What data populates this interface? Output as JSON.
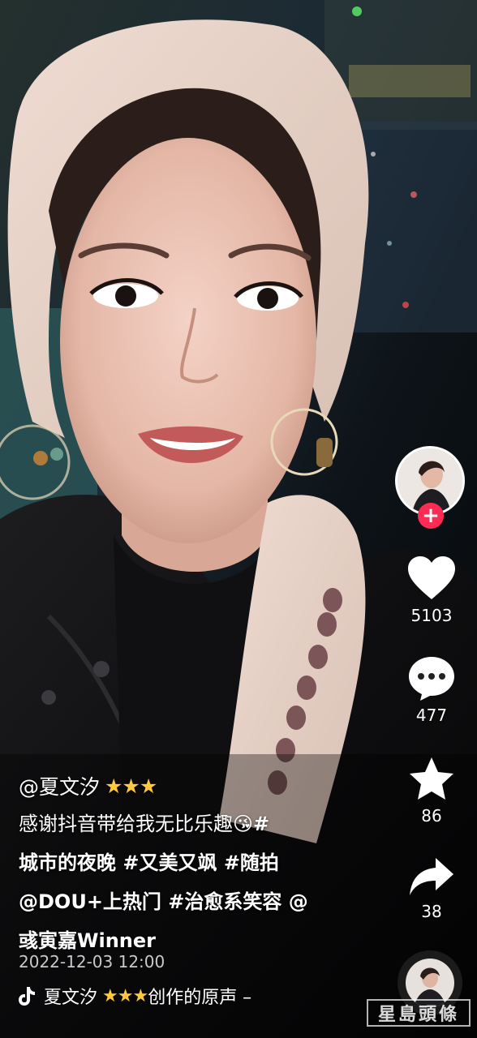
{
  "video": {
    "description_icon": "selfie-video-frame"
  },
  "sidebar": {
    "avatar_icon": "creator-avatar",
    "follow_symbol": "+",
    "likes": "5103",
    "comments": "477",
    "favorites": "86",
    "shares": "38"
  },
  "caption": {
    "author": "@夏文汐",
    "author_stars": "★★★",
    "line1_text": "感谢抖音带给我无比乐趣",
    "line1_emoji": "😘",
    "line1_hash": "#",
    "line2": "城市的夜晚 #又美又飒 #随拍",
    "line3": "@DOU+上热门 #治愈系笑容 @",
    "line4": "彧寅嘉Winner",
    "date": "2022-12-03 12:00"
  },
  "music": {
    "icon": "tiktok-note-icon",
    "artist": "夏文汐 ",
    "stars": "★★★",
    "label": "创作的原声 –"
  },
  "watermark": {
    "text": "星島頭條"
  },
  "colors": {
    "accent_red": "#fe2c55",
    "star_yellow": "#ffc83d"
  }
}
